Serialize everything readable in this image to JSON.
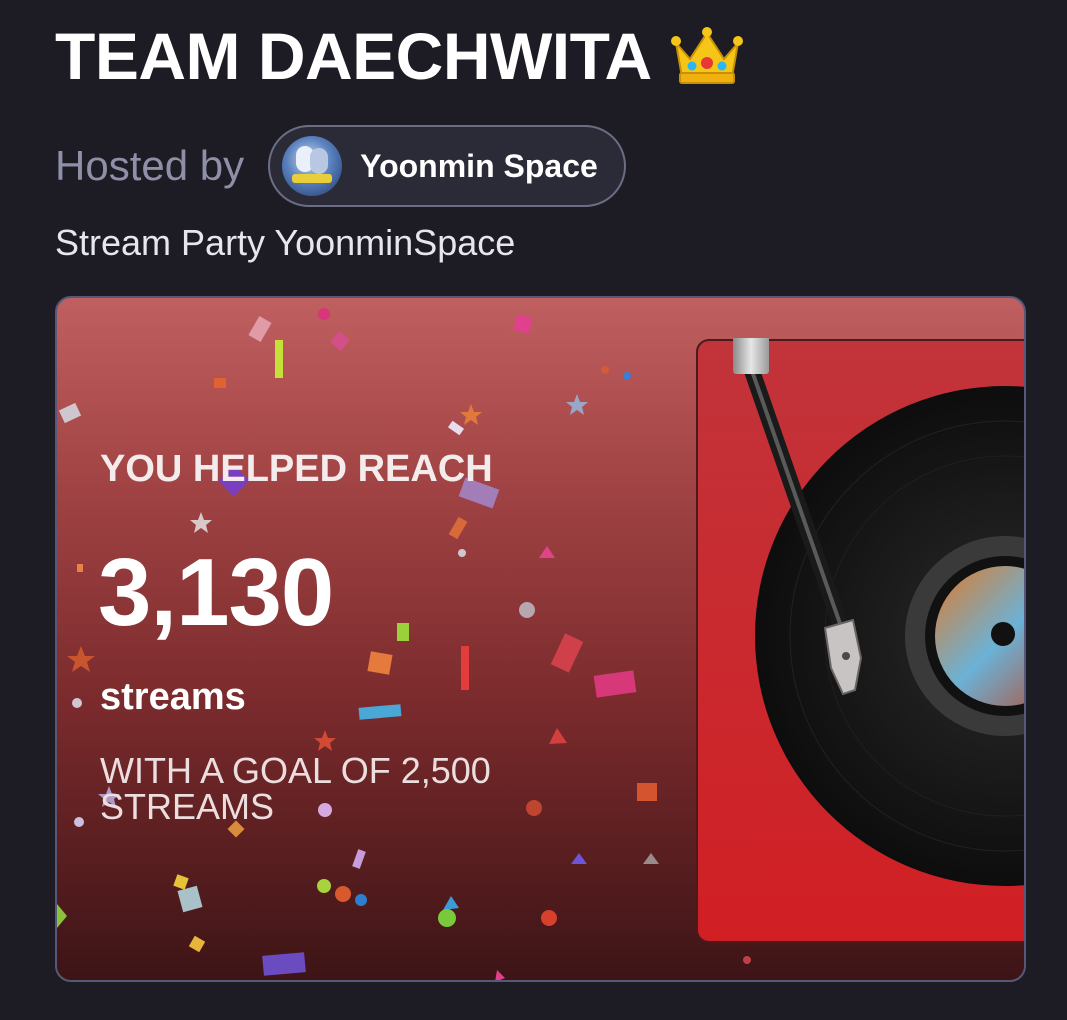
{
  "header": {
    "title": "TEAM DAECHWITA",
    "title_icon": "crown-emoji"
  },
  "host": {
    "prefix": "Hosted by",
    "name": "Yoonmin Space",
    "avatar": "profile-avatar"
  },
  "event": {
    "subtitle": "Stream Party YoonminSpace"
  },
  "card": {
    "reach_label": "YOU HELPED REACH",
    "count": "3,130",
    "count_unit": "streams",
    "goal_text": "WITH A GOAL OF 2,500 STREAMS",
    "decoration": "turntable-with-vinyl-record",
    "colors": {
      "gradient_top": "#c05f60",
      "gradient_bottom": "#3d1416",
      "turntable_red": "#c9242a",
      "vinyl": "#141414"
    }
  },
  "colors": {
    "background": "#1d1c25",
    "muted_text": "#8f90a8",
    "chip_border": "#6b6d84"
  }
}
